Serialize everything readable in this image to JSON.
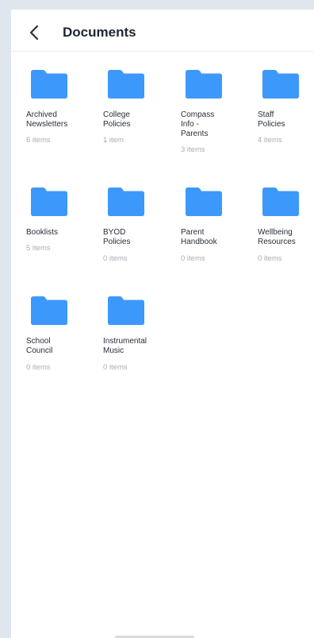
{
  "header": {
    "title": "Documents",
    "back_icon": "chevron-left-icon"
  },
  "folders": [
    {
      "name": "Archived\nNewsletters",
      "count": "6 items"
    },
    {
      "name": "College\nPolicies",
      "count": "1 item"
    },
    {
      "name": "Compass\nInfo -\nParents",
      "count": "3 items"
    },
    {
      "name": "Staff\nPolicies",
      "count": "4 items"
    },
    {
      "name": "Booklists",
      "count": "5 items"
    },
    {
      "name": "BYOD\nPolicies",
      "count": "0 items"
    },
    {
      "name": "Parent\nHandbook",
      "count": "0 items"
    },
    {
      "name": "Wellbeing\nResources",
      "count": "0 items"
    },
    {
      "name": "School\nCouncil",
      "count": "0 items"
    },
    {
      "name": "Instrumental\nMusic",
      "count": "0 items"
    }
  ],
  "colors": {
    "folder": "#3d98fb",
    "background": "#dfe6ee",
    "title": "#1d2533",
    "muted": "#a8adb5"
  }
}
